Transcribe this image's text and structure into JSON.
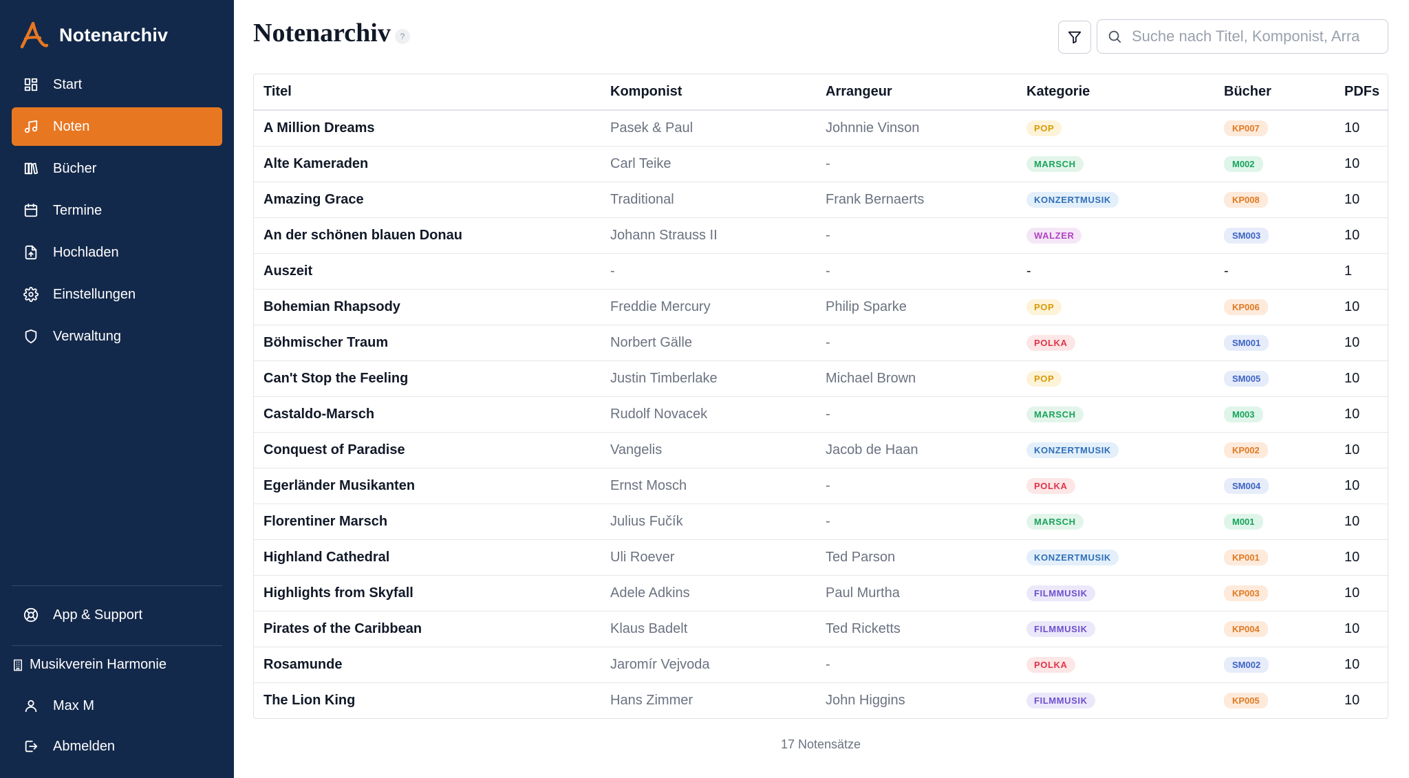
{
  "app": {
    "name": "Notenarchiv"
  },
  "sidebar": {
    "items": [
      {
        "label": "Start",
        "icon": "dashboard-icon"
      },
      {
        "label": "Noten",
        "icon": "music-note-icon",
        "active": true
      },
      {
        "label": "Bücher",
        "icon": "library-icon"
      },
      {
        "label": "Termine",
        "icon": "calendar-icon"
      },
      {
        "label": "Hochladen",
        "icon": "upload-file-icon"
      },
      {
        "label": "Einstellungen",
        "icon": "gear-icon"
      },
      {
        "label": "Verwaltung",
        "icon": "shield-icon"
      }
    ],
    "support_label": "App & Support",
    "org_label": "Musikverein Harmonie",
    "user_label": "Max M",
    "logout_label": "Abmelden"
  },
  "header": {
    "title": "Notenarchiv",
    "help": "?",
    "search_placeholder": "Suche nach Titel, Komponist, Arra"
  },
  "table": {
    "columns": [
      "Titel",
      "Komponist",
      "Arrangeur",
      "Kategorie",
      "Bücher",
      "PDFs"
    ],
    "rows": [
      {
        "title": "A Million Dreams",
        "composer": "Pasek & Paul",
        "arranger": "Johnnie Vinson",
        "category": "POP",
        "book": "KP007",
        "pdfs": "10"
      },
      {
        "title": "Alte Kameraden",
        "composer": "Carl Teike",
        "arranger": "-",
        "category": "MARSCH",
        "book": "M002",
        "pdfs": "10"
      },
      {
        "title": "Amazing Grace",
        "composer": "Traditional",
        "arranger": "Frank Bernaerts",
        "category": "KONZERTMUSIK",
        "book": "KP008",
        "pdfs": "10"
      },
      {
        "title": "An der schönen blauen Donau",
        "composer": "Johann Strauss II",
        "arranger": "-",
        "category": "WALZER",
        "book": "SM003",
        "pdfs": "10"
      },
      {
        "title": "Auszeit",
        "composer": "-",
        "arranger": "-",
        "category": "-",
        "book": "-",
        "pdfs": "1"
      },
      {
        "title": "Bohemian Rhapsody",
        "composer": "Freddie Mercury",
        "arranger": "Philip Sparke",
        "category": "POP",
        "book": "KP006",
        "pdfs": "10"
      },
      {
        "title": "Böhmischer Traum",
        "composer": "Norbert Gälle",
        "arranger": "-",
        "category": "POLKA",
        "book": "SM001",
        "pdfs": "10"
      },
      {
        "title": "Can't Stop the Feeling",
        "composer": "Justin Timberlake",
        "arranger": "Michael Brown",
        "category": "POP",
        "book": "SM005",
        "pdfs": "10"
      },
      {
        "title": "Castaldo-Marsch",
        "composer": "Rudolf Novacek",
        "arranger": "-",
        "category": "MARSCH",
        "book": "M003",
        "pdfs": "10"
      },
      {
        "title": "Conquest of Paradise",
        "composer": "Vangelis",
        "arranger": "Jacob de Haan",
        "category": "KONZERTMUSIK",
        "book": "KP002",
        "pdfs": "10"
      },
      {
        "title": "Egerländer Musikanten",
        "composer": "Ernst Mosch",
        "arranger": "-",
        "category": "POLKA",
        "book": "SM004",
        "pdfs": "10"
      },
      {
        "title": "Florentiner Marsch",
        "composer": "Julius Fučík",
        "arranger": "-",
        "category": "MARSCH",
        "book": "M001",
        "pdfs": "10"
      },
      {
        "title": "Highland Cathedral",
        "composer": "Uli Roever",
        "arranger": "Ted Parson",
        "category": "KONZERTMUSIK",
        "book": "KP001",
        "pdfs": "10"
      },
      {
        "title": "Highlights from Skyfall",
        "composer": "Adele Adkins",
        "arranger": "Paul Murtha",
        "category": "FILMMUSIK",
        "book": "KP003",
        "pdfs": "10"
      },
      {
        "title": "Pirates of the Caribbean",
        "composer": "Klaus Badelt",
        "arranger": "Ted Ricketts",
        "category": "FILMMUSIK",
        "book": "KP004",
        "pdfs": "10"
      },
      {
        "title": "Rosamunde",
        "composer": "Jaromír Vejvoda",
        "arranger": "-",
        "category": "POLKA",
        "book": "SM002",
        "pdfs": "10"
      },
      {
        "title": "The Lion King",
        "composer": "Hans Zimmer",
        "arranger": "John Higgins",
        "category": "FILMMUSIK",
        "book": "KP005",
        "pdfs": "10"
      }
    ]
  },
  "footer": {
    "count_label": "17 Notensätze"
  },
  "colors": {
    "sidebar_bg": "#13294b",
    "accent": "#e87722"
  }
}
